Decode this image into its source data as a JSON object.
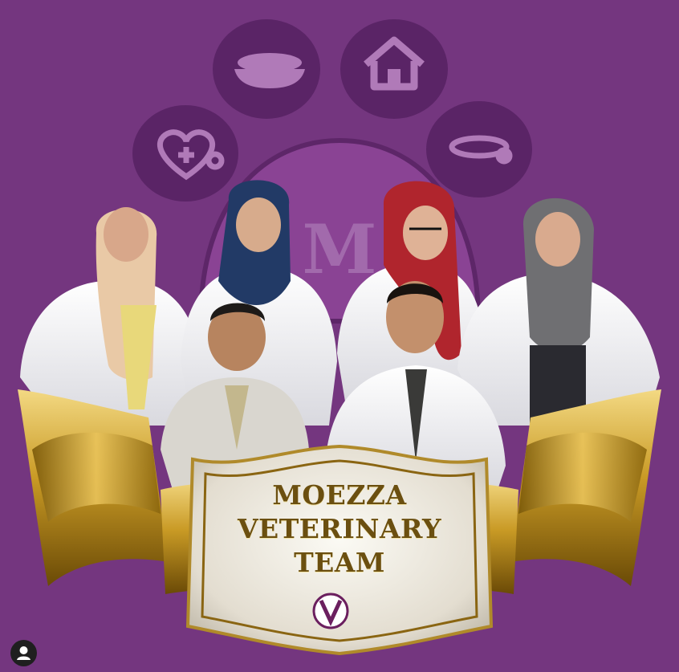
{
  "image": {
    "description_colors": {
      "background": "#74367f",
      "paw_pad": "#5a2466",
      "paw_icon": "#b07ab8",
      "ribbon_gold": "#c99a25",
      "badge_fill": "#e9e6de",
      "title_text": "#6b4f10"
    },
    "icons": [
      "heart-stethoscope-icon",
      "food-bowl-icon",
      "house-icon",
      "collar-icon",
      "user-account-icon",
      "vet-logo-icon"
    ]
  },
  "badge": {
    "line1": "MOEZZA",
    "line2": "VETERINARY",
    "line3": "TEAM"
  }
}
